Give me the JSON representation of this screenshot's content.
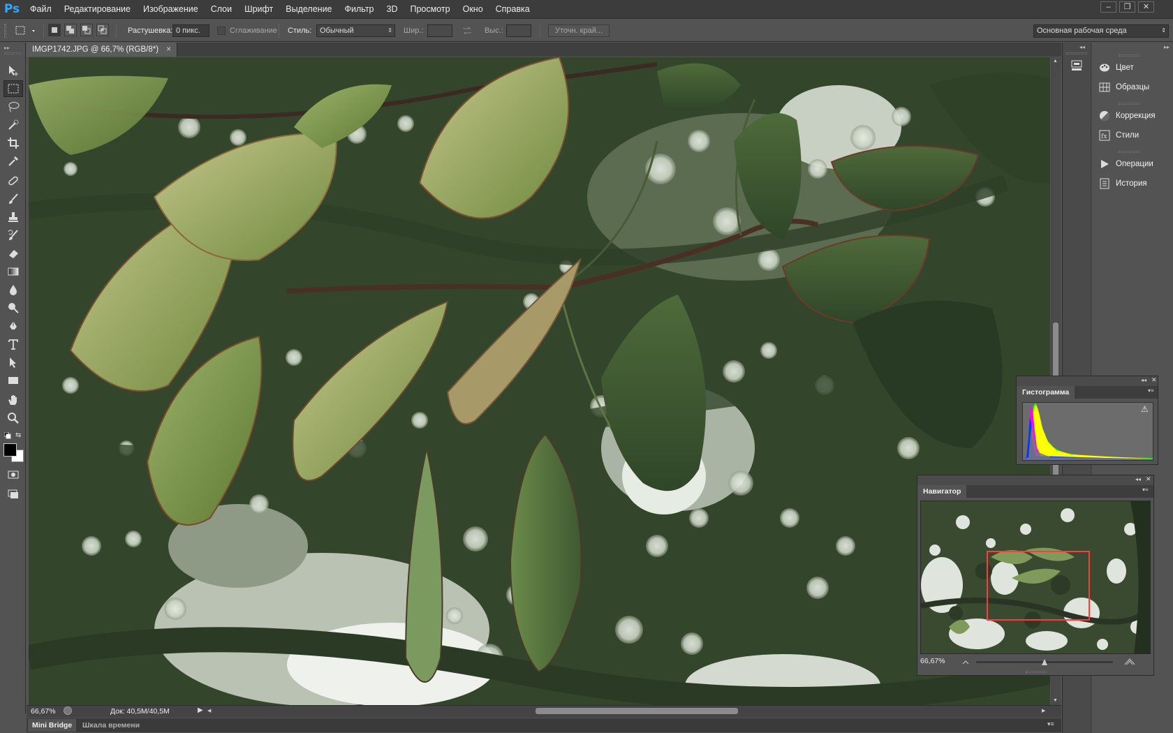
{
  "app": {
    "logo": "Ps"
  },
  "menu": [
    "Файл",
    "Редактирование",
    "Изображение",
    "Слои",
    "Шрифт",
    "Выделение",
    "Фильтр",
    "3D",
    "Просмотр",
    "Окно",
    "Справка"
  ],
  "window_controls": {
    "minimize": "–",
    "restore": "❐",
    "close": "✕"
  },
  "options": {
    "feather_label": "Растушевка:",
    "feather_value": "0 пикс.",
    "antialias_label": "Сглаживание",
    "style_label": "Стиль:",
    "style_value": "Обычный",
    "width_label": "Шир.:",
    "height_label": "Выс.:",
    "refine_label": "Уточн. край...",
    "workspace": "Основная рабочая среда"
  },
  "document": {
    "tab_title": "IMGP1742.JPG @ 66,7% (RGB/8*)",
    "tab_close": "×",
    "zoom": "66,67%",
    "doc_size": "Док: 40,5M/40,5M"
  },
  "bottom_tabs": [
    "Mini Bridge",
    "Шкала времени"
  ],
  "dock": {
    "groups": [
      [
        {
          "label": "Цвет",
          "icon": "palette-icon"
        },
        {
          "label": "Образцы",
          "icon": "swatches-icon"
        }
      ],
      [
        {
          "label": "Коррекция",
          "icon": "adjustments-icon"
        },
        {
          "label": "Стили",
          "icon": "styles-icon"
        }
      ],
      [
        {
          "label": "Операции",
          "icon": "play-icon"
        },
        {
          "label": "История",
          "icon": "history-icon"
        }
      ]
    ]
  },
  "histogram_panel": {
    "title": "Гистограмма",
    "warning": "⚠"
  },
  "navigator_panel": {
    "title": "Навигатор",
    "zoom": "66,67%"
  },
  "colors": {
    "accent": "#30a8ff",
    "chrome_dark": "#3c3c3c",
    "chrome": "#535353",
    "nav_box": "#ff3b3b"
  },
  "tools": [
    "move-tool-icon",
    "marquee-tool-icon",
    "lasso-tool-icon",
    "quick-select-tool-icon",
    "crop-tool-icon",
    "eyedropper-tool-icon",
    "healing-brush-tool-icon",
    "brush-tool-icon",
    "clone-stamp-tool-icon",
    "history-brush-tool-icon",
    "eraser-tool-icon",
    "gradient-tool-icon",
    "blur-tool-icon",
    "dodge-tool-icon",
    "pen-tool-icon",
    "type-tool-icon",
    "path-select-tool-icon",
    "rectangle-tool-icon",
    "hand-tool-icon",
    "zoom-tool-icon"
  ]
}
